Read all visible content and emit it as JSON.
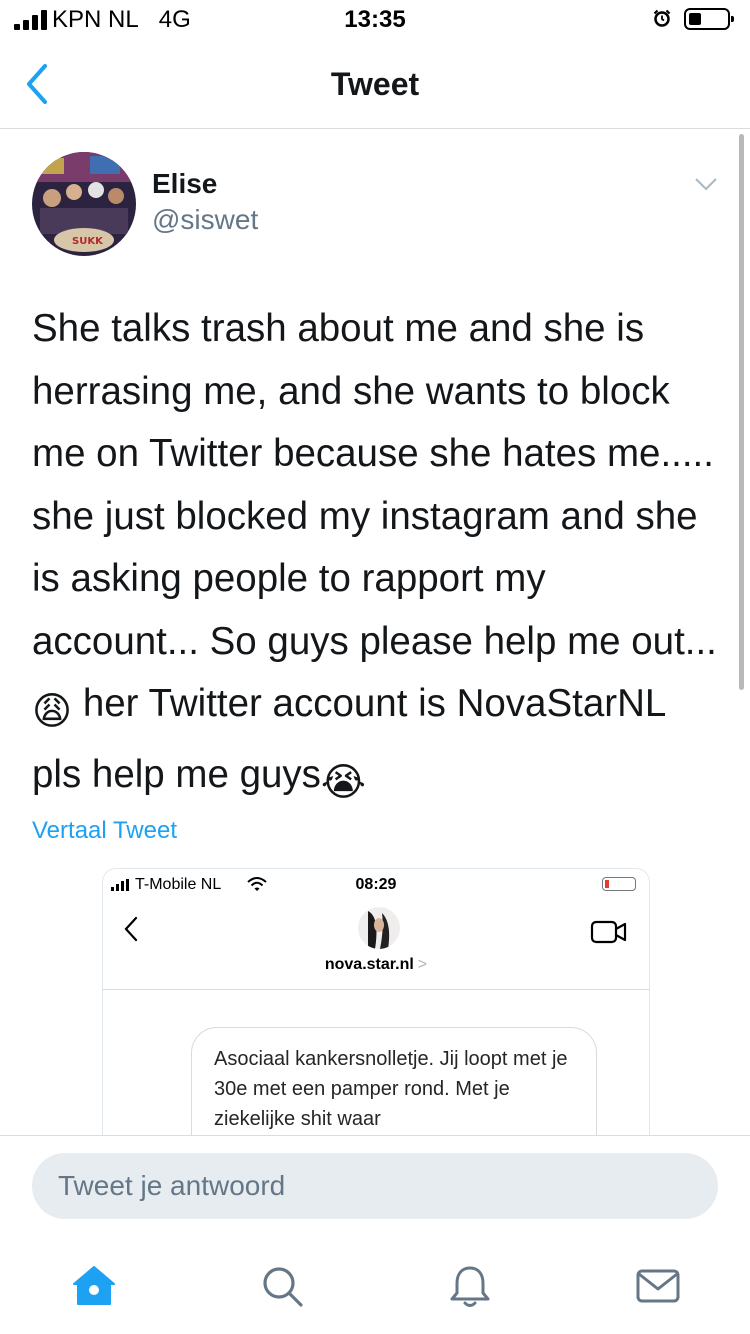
{
  "status_bar": {
    "carrier": "KPN NL",
    "network": "4G",
    "time": "13:35"
  },
  "nav": {
    "title": "Tweet"
  },
  "tweet": {
    "author_name": "Elise",
    "author_handle": "@siswet",
    "text_part1": "She talks trash about me and she is herrasing me, and she wants to block me on Twitter because she hates me..... she just blocked my instagram and she is asking people to rapport my account... So guys please help me out... ",
    "emoji1": "😩",
    "text_part2": "  her Twitter account is NovaStarNL pls help me guys",
    "emoji2": "😭",
    "translate_label": "Vertaal Tweet"
  },
  "media": {
    "carrier": "T-Mobile NL",
    "time": "08:29",
    "username": "nova.star.nl",
    "username_chevron": ">",
    "message": "Asociaal kankersnolletje. Jij loopt met je 30e met een pamper rond. Met je ziekelijke shit waar"
  },
  "reply": {
    "placeholder": "Tweet je antwoord"
  },
  "tabs": [
    {
      "icon": "home-icon",
      "active": true
    },
    {
      "icon": "search-icon",
      "active": false
    },
    {
      "icon": "notifications-icon",
      "active": false
    },
    {
      "icon": "messages-icon",
      "active": false
    }
  ],
  "colors": {
    "accent": "#1da1f2",
    "secondary_text": "#657786",
    "input_bg": "#e6ecf0"
  }
}
